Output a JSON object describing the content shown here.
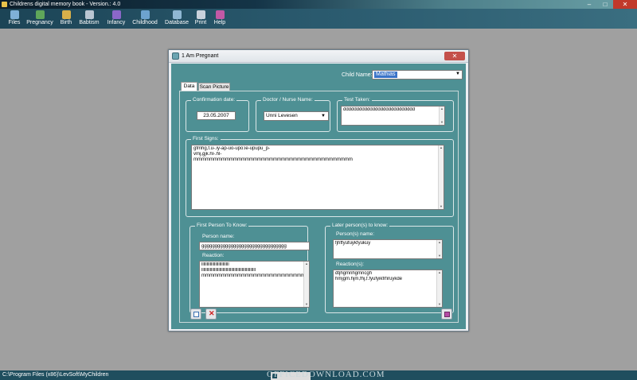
{
  "app": {
    "title": "Childrens digital memory book - Version.: 4.0",
    "controls": [
      "–",
      "□",
      "✕"
    ]
  },
  "menu": [
    {
      "label": "Files",
      "icon": "files-icon",
      "color": "#7fb0d8"
    },
    {
      "label": "Pregnancy",
      "icon": "pregnancy-icon",
      "color": "#5fa65a"
    },
    {
      "label": "Birth",
      "icon": "birth-icon",
      "color": "#d8b04a"
    },
    {
      "label": "Babtism",
      "icon": "babtism-icon",
      "color": "#b9c6d2"
    },
    {
      "label": "Infancy",
      "icon": "infancy-icon",
      "color": "#8a67c8"
    },
    {
      "label": "Childhood",
      "icon": "childhood-icon",
      "color": "#6da3cf"
    },
    {
      "label": "Database",
      "icon": "database-icon",
      "color": "#8fb7d3"
    },
    {
      "label": "Print",
      "icon": "print-icon",
      "color": "#c9d2dc"
    },
    {
      "label": "Help",
      "icon": "help-icon",
      "color": "#c259a6"
    }
  ],
  "status": {
    "path": "C:\\Program Files (x86)\\LevSoft\\MyChildren",
    "watermark": "OFFICEDOWNLOAD.COM"
  },
  "dialog": {
    "title": "1 Am Pregnant",
    "close": "✕",
    "child_label": "Child Name:",
    "child_value": "Mathias",
    "tabs": [
      "Data",
      "Scan Picture"
    ],
    "confirmation": {
      "label": "Confirmation date:",
      "value": "23.05.2007"
    },
    "doctor": {
      "label": "Doctor / Nurse Name:",
      "value": "Unni Levesen"
    },
    "test": {
      "label": "Test Taken:",
      "value": "ddddddddddddddddddddddddddd"
    },
    "first_signs": {
      "label": "First Signs:",
      "lines": [
        "gfmhg,f.u-.iy-ap-uo-upo:ie-upupu_p-",
        "vmj,gjk.hl-.hl-",
        "mmmmmmmmmmmmmmmmmmmmmmmmmmmmmmmmmmmmmmmm"
      ]
    },
    "first_person": {
      "label": "First Person To Know:",
      "name_label": "Person name:",
      "name_value": "gggggggggggggggggggggggggggggggg",
      "reaction_label": "Reaction:",
      "reaction_lines": [
        "llllllllllllllllllllllllll",
        "lllllllllllllllllllllllllllllllllllllllllllllllllll",
        "mmmmmmmmmmmmmmmmmmmmmmmmmmmm"
      ]
    },
    "later_persons": {
      "label": "Later person(s) to know:",
      "names_label": "Person(s) name:",
      "names_lines": [
        "fjhffyufuykfyukuy"
      ],
      "reactions_label": "Reaction(s):",
      "reactions_lines": [
        "dtjhgmnhgmncgh",
        "hmjgm.hjm,fhj,f.fyufyikfrfiruykde"
      ]
    }
  }
}
